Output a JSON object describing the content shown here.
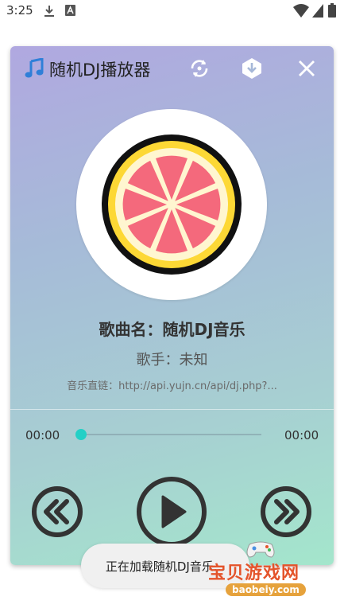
{
  "status_bar": {
    "time": "3:25"
  },
  "header": {
    "title": "随机DJ播放器"
  },
  "song": {
    "title": "歌曲名：随机DJ音乐",
    "artist": "歌手：未知",
    "link": "音乐直链：http://api.yujn.cn/api/dj.php?..."
  },
  "progress": {
    "current": "00:00",
    "total": "00:00",
    "fraction": 0
  },
  "toast": {
    "text": "正在加载随机DJ音乐..."
  },
  "watermark": {
    "text": "宝贝游戏网",
    "sub": "baobeiy.com"
  },
  "colors": {
    "accent": "#23d0c6",
    "control": "#333333"
  }
}
